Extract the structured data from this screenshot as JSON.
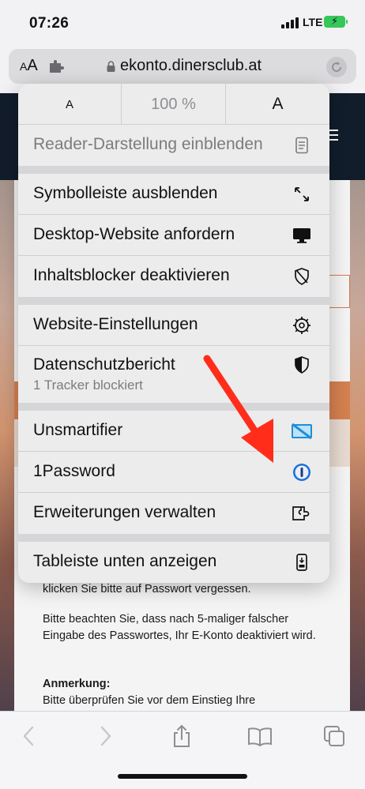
{
  "status_bar": {
    "time": "07:26",
    "network": "LTE"
  },
  "address_bar": {
    "aa_small": "A",
    "aa_large": "A",
    "url": "ekonto.dinersclub.at"
  },
  "popup": {
    "zoom_small": "A",
    "zoom_value": "100 %",
    "zoom_large": "A",
    "items": [
      {
        "label": "Reader-Darstellung einblenden",
        "icon": "reader-icon"
      },
      {
        "label": "Symbolleiste ausblenden",
        "icon": "expand-arrows-icon"
      },
      {
        "label": "Desktop-Website anfordern",
        "icon": "desktop-icon"
      },
      {
        "label": "Inhaltsblocker deaktivieren",
        "icon": "shield-slash-icon"
      },
      {
        "label": "Website-Einstellungen",
        "icon": "gear-icon"
      },
      {
        "label": "Datenschutzbericht",
        "sub": "1 Tracker blockiert",
        "icon": "privacy-shield-icon"
      },
      {
        "label": "Unsmartifier",
        "icon": "unsmartifier-icon"
      },
      {
        "label": "1Password",
        "icon": "onepassword-icon"
      },
      {
        "label": "Erweiterungen verwalten",
        "icon": "extension-icon"
      },
      {
        "label": "Tableiste unten anzeigen",
        "icon": "tabbar-bottom-icon"
      }
    ]
  },
  "page": {
    "text_1": "klicken Sie bitte auf Passwort vergessen.",
    "text_2": "Bitte beachten Sie, dass nach 5-maliger falscher Eingabe des Passwortes, Ihr E-Konto deaktiviert wird.",
    "note_heading": "Anmerkung:",
    "text_3": "Bitte überprüfen Sie vor dem Einstieg Ihre"
  },
  "colors": {
    "accent_red": "#ff2d1a",
    "header_navy": "#121d2b",
    "battery_green": "#34c759",
    "unsmartifier_blue": "#1e8fd6",
    "onepassword_blue": "#1a6fd9"
  }
}
